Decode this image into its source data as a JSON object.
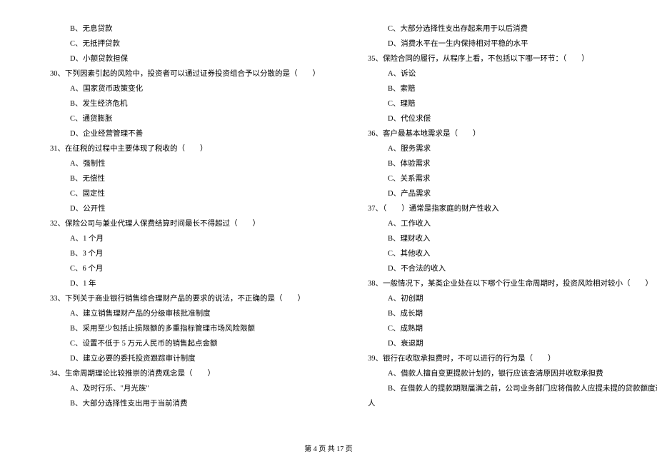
{
  "left_column": [
    {
      "type": "option",
      "text": "B、无息贷款"
    },
    {
      "type": "option",
      "text": "C、无抵押贷款"
    },
    {
      "type": "option",
      "text": "D、小额贷款担保"
    },
    {
      "type": "question",
      "text": "30、下列因素引起的风险中，投资者可以通过证券投资组合予以分散的是（　　）"
    },
    {
      "type": "option",
      "text": "A、国家货币政策变化"
    },
    {
      "type": "option",
      "text": "B、发生经济危机"
    },
    {
      "type": "option",
      "text": "C、通货膨胀"
    },
    {
      "type": "option",
      "text": "D、企业经营管理不善"
    },
    {
      "type": "question",
      "text": "31、在征税的过程中主要体现了税收的（　　）"
    },
    {
      "type": "option",
      "text": "A、强制性"
    },
    {
      "type": "option",
      "text": "B、无偿性"
    },
    {
      "type": "option",
      "text": "C、固定性"
    },
    {
      "type": "option",
      "text": "D、公开性"
    },
    {
      "type": "question",
      "text": "32、保险公司与兼业代理人保费结算时间最长不得超过（　　）"
    },
    {
      "type": "option",
      "text": "A、1 个月"
    },
    {
      "type": "option",
      "text": "B、3 个月"
    },
    {
      "type": "option",
      "text": "C、6 个月"
    },
    {
      "type": "option",
      "text": "D、1 年"
    },
    {
      "type": "question",
      "text": "33、下列关于商业银行销售综合理财产品的要求的说法，不正确的是（　　）"
    },
    {
      "type": "option",
      "text": "A、建立销售理财产品的分级审核批准制度"
    },
    {
      "type": "option",
      "text": "B、采用至少包括止损限额的多重指标管理市场风险限额"
    },
    {
      "type": "option",
      "text": "C、设置不低于 5 万元人民币的销售起点金额"
    },
    {
      "type": "option",
      "text": "D、建立必要的委托投资跟踪审计制度"
    },
    {
      "type": "question",
      "text": "34、生命周期理论比较推崇的消费观念是（　　）"
    },
    {
      "type": "option",
      "text": "A、及时行乐、\"月光族\""
    },
    {
      "type": "option",
      "text": "B、大部分选择性支出用于当前消费"
    }
  ],
  "right_column": [
    {
      "type": "option",
      "text": "C、大部分选择性支出存起来用于以后消费"
    },
    {
      "type": "option",
      "text": "D、消费水平在一生内保持相对平稳的水平"
    },
    {
      "type": "question",
      "text": "35、保险合同的履行，从程序上看，不包括以下哪一环节：（　　）"
    },
    {
      "type": "option",
      "text": "A、诉讼"
    },
    {
      "type": "option",
      "text": "B、索赔"
    },
    {
      "type": "option",
      "text": "C、理赔"
    },
    {
      "type": "option",
      "text": "D、代位求偿"
    },
    {
      "type": "question",
      "text": "36、客户最基本地需求是（　　）"
    },
    {
      "type": "option",
      "text": "A、服务需求"
    },
    {
      "type": "option",
      "text": "B、体验需求"
    },
    {
      "type": "option",
      "text": "C、关系需求"
    },
    {
      "type": "option",
      "text": "D、产品需求"
    },
    {
      "type": "question",
      "text": "37、（　　）通常是指家庭的财产性收入"
    },
    {
      "type": "option",
      "text": "A、工作收入"
    },
    {
      "type": "option",
      "text": "B、理财收入"
    },
    {
      "type": "option",
      "text": "C、其他收入"
    },
    {
      "type": "option",
      "text": "D、不合法的收入"
    },
    {
      "type": "question",
      "text": "38、一般情况下，某类企业处在以下哪个行业生命周期时，投资风险相对较小（　　）"
    },
    {
      "type": "option",
      "text": "A、初创期"
    },
    {
      "type": "option",
      "text": "B、成长期"
    },
    {
      "type": "option",
      "text": "C、成熟期"
    },
    {
      "type": "option",
      "text": "D、衰退期"
    },
    {
      "type": "question",
      "text": "39、银行在收取承担费时，不可以进行的行为是（　　）"
    },
    {
      "type": "option",
      "text": "A、借款人擅自变更提款计划的，银行应该查清原因并收取承担费"
    },
    {
      "type": "option",
      "text": "B、在借款人的提款期限届满之前，公司业务部门应将借款人应提未提的贷款额度通知借款"
    },
    {
      "type": "indent-right",
      "text": "人"
    }
  ],
  "footer": "第 4 页 共 17 页"
}
